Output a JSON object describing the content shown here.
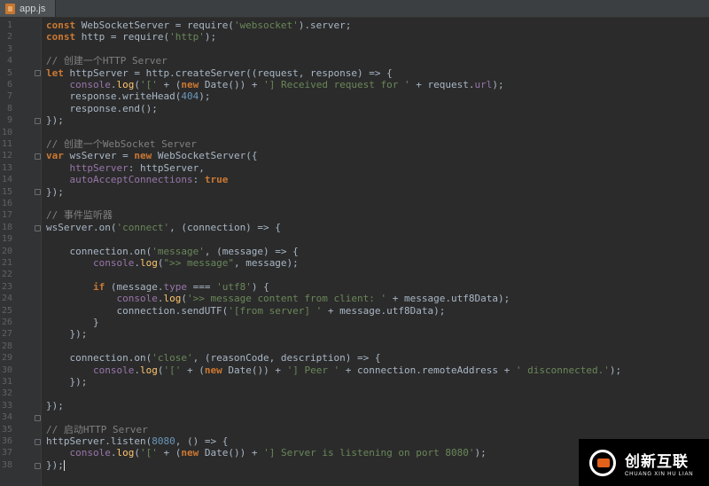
{
  "tab": {
    "filename": "app.js",
    "icon": "js-file-icon"
  },
  "editor": {
    "line_numbers": [
      "1",
      "2",
      "3",
      "4",
      "5",
      "6",
      "7",
      "8",
      "9",
      "10",
      "11",
      "12",
      "13",
      "14",
      "15",
      "16",
      "17",
      "18",
      "19",
      "20",
      "21",
      "22",
      "23",
      "24",
      "25",
      "26",
      "27",
      "28",
      "29",
      "30",
      "31",
      "32",
      "33",
      "34",
      "35",
      "36",
      "37",
      "38"
    ]
  },
  "logo": {
    "main": "创新互联",
    "sub": "CHUANG XIN HU LIAN"
  }
}
